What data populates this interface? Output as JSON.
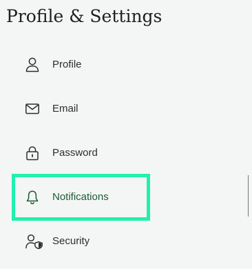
{
  "page": {
    "title": "Profile & Settings"
  },
  "nav": {
    "items": [
      {
        "label": "Profile",
        "icon": "person-icon",
        "active": false
      },
      {
        "label": "Email",
        "icon": "envelope-icon",
        "active": false
      },
      {
        "label": "Password",
        "icon": "lock-icon",
        "active": false
      },
      {
        "label": "Notifications",
        "icon": "bell-icon",
        "active": true
      },
      {
        "label": "Security",
        "icon": "user-shield-icon",
        "active": false
      }
    ]
  },
  "colors": {
    "background": "#f4f6f5",
    "active_text": "#1c5a34",
    "focus_ring": "#21f0ae",
    "text": "#2a2f2c"
  }
}
